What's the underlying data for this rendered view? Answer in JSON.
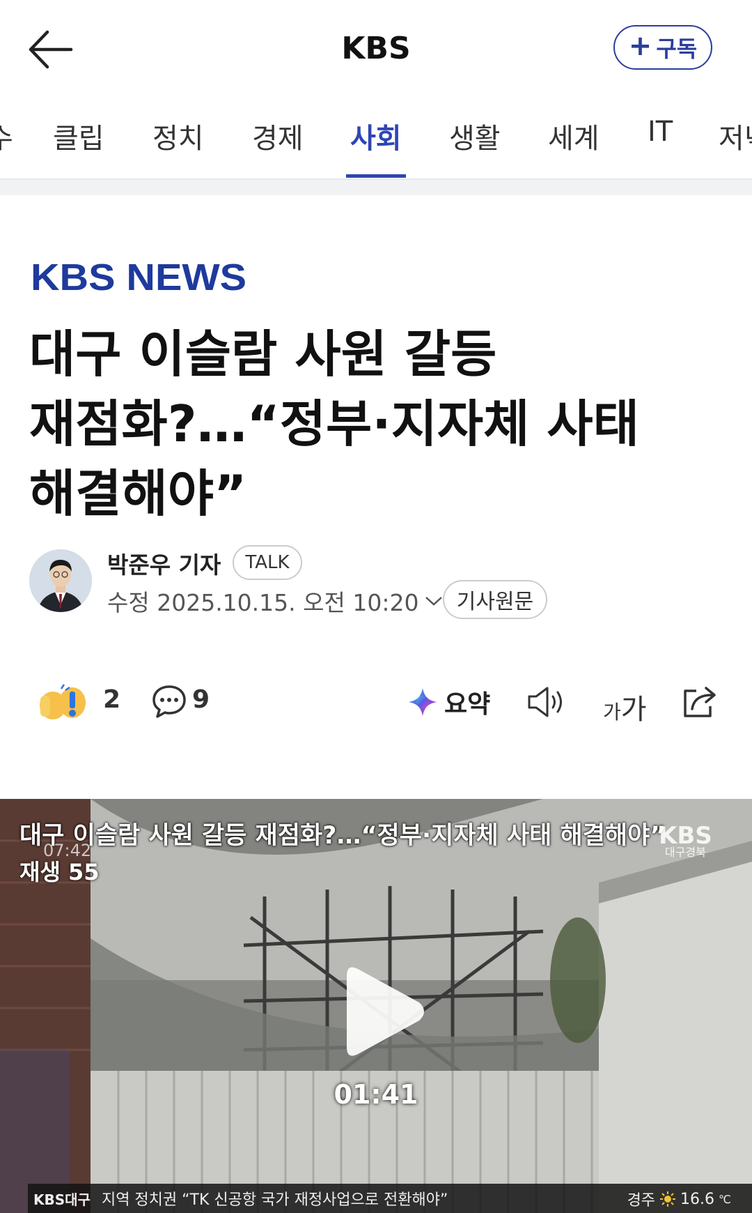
{
  "header": {
    "title": "KBS",
    "subscribe_label": "구독"
  },
  "tabs": [
    "수",
    "클립",
    "정치",
    "경제",
    "사회",
    "생활",
    "세계",
    "IT",
    "저녁"
  ],
  "active_tab": "사회",
  "article": {
    "brand": "KBS NEWS",
    "headline": "대구 이슬람 사원 갈등 재점화?…“정부·지자체 사태 해결해야”",
    "reporter": "박준우 기자",
    "talk_label": "TALK",
    "date": "수정 2025.10.15. 오전 10:20",
    "origin_label": "기사원문"
  },
  "actions": {
    "reaction_count": "2",
    "comment_count": "9",
    "summary_label": "요약",
    "font_label_small": "가",
    "font_label_large": "가"
  },
  "video": {
    "title": "대구 이슬람 사원 갈등 재점화?…“정부·지자체 사태 해결해야”",
    "time_overlay": "07:42",
    "views": "재생 55",
    "logo": "KBS",
    "logo_sub": "대구경북",
    "duration": "01:41",
    "ticker_brand": "KBS대구",
    "ticker_text": "지역 정치권 “TK 신공항 국가 재정사업으로 전환해야”",
    "weather_city": "경주",
    "weather_temp": "16.6",
    "weather_unit": "℃"
  },
  "colors": {
    "accent": "#2f45b4",
    "brand_blue": "#1e3a9c",
    "subscribe": "#2c3d9c"
  }
}
